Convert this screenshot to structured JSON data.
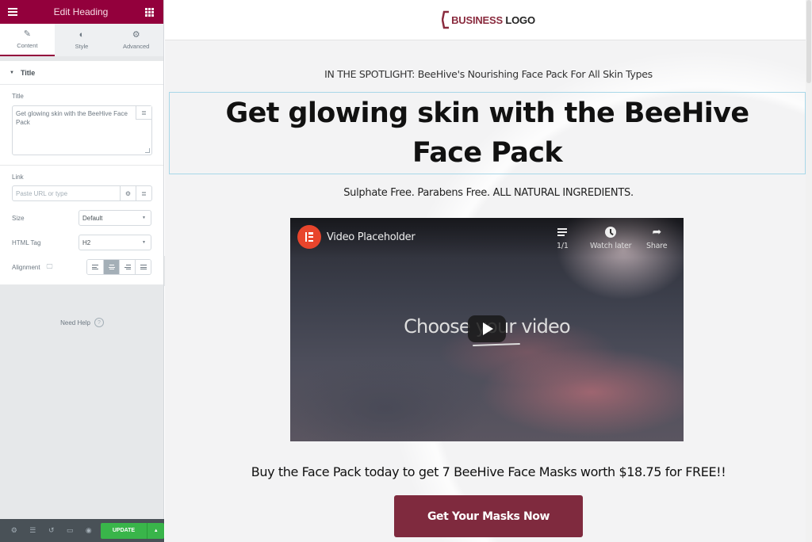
{
  "editor": {
    "header": {
      "title": "Edit Heading",
      "menu_icon": "hamburger-icon",
      "widgets_icon": "grid-icon"
    },
    "tabs": [
      {
        "label": "Content",
        "icon": "pencil-icon",
        "active": true
      },
      {
        "label": "Style",
        "icon": "half-circle-icon",
        "active": false
      },
      {
        "label": "Advanced",
        "icon": "gear-icon",
        "active": false
      }
    ],
    "section": {
      "label": "Title",
      "expanded": true
    },
    "title_control": {
      "label": "Title",
      "value": "Get glowing skin with the BeeHive Face Pack"
    },
    "link_control": {
      "label": "Link",
      "placeholder": "Paste URL or type",
      "value": ""
    },
    "size_control": {
      "label": "Size",
      "value": "Default"
    },
    "html_tag_control": {
      "label": "HTML Tag",
      "value": "H2"
    },
    "alignment_control": {
      "label": "Alignment",
      "options": [
        "left",
        "center",
        "right",
        "justify"
      ],
      "selected": "center"
    },
    "need_help": {
      "label": "Need Help",
      "icon": "?"
    },
    "footer": {
      "icons": [
        "settings-icon",
        "navigator-icon",
        "history-icon",
        "responsive-icon",
        "preview-icon"
      ],
      "update_label": "UPDATE",
      "update_color": "#39b54a"
    },
    "accent_color": "#93003c"
  },
  "page": {
    "logo": {
      "part1": "BUSINESS",
      "part2": " LOGO",
      "color": "#8a2b3e"
    },
    "spotlight": "IN THE SPOTLIGHT: BeeHive's Nourishing Face Pack For All Skin Types",
    "heading": "Get glowing skin with the BeeHive Face Pack",
    "subline": "Sulphate Free. Parabens Free. ALL NATURAL INGREDIENTS.",
    "video": {
      "title": "Video Placeholder",
      "queue_label": "1/1",
      "watch_later_label": "Watch later",
      "share_label": "Share",
      "center_text": "Choose your video"
    },
    "buy_line": "Buy the Face Pack today to get 7 BeeHive Face Masks worth $18.75 for FREE!!",
    "cta_label": "Get Your Masks Now",
    "cta_color": "#7f2a3e"
  }
}
